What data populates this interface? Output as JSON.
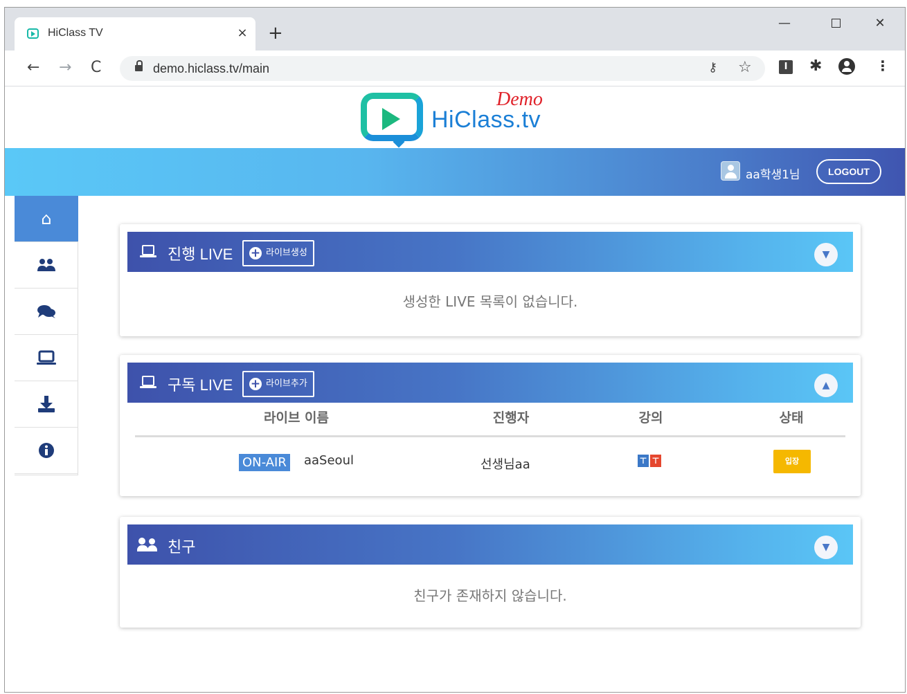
{
  "browser": {
    "tab_title": "HiClass TV",
    "tab_close": "×",
    "new_tab": "+",
    "url": "demo.hiclass.tv/main",
    "window_controls": {
      "minimize": "—",
      "close": "✕"
    },
    "nav": {
      "back": "←",
      "forward": "→",
      "reload": "C"
    },
    "icons": [
      "lock-icon",
      "key-icon",
      "star-icon",
      "extension-i-icon",
      "puzzle-icon",
      "account-icon",
      "menu-icon"
    ]
  },
  "logo": {
    "text": "HiClass.tv",
    "badge": "Demo"
  },
  "header": {
    "user_name": "aa학생1님",
    "logout_label": "LOGOUT"
  },
  "sidebar": {
    "items": [
      {
        "name": "home",
        "icon": "home-icon",
        "active": true
      },
      {
        "name": "users",
        "icon": "users-icon",
        "active": false
      },
      {
        "name": "chat",
        "icon": "comments-icon",
        "active": false
      },
      {
        "name": "live",
        "icon": "laptop-icon",
        "active": false
      },
      {
        "name": "download",
        "icon": "download-icon",
        "active": false
      },
      {
        "name": "info",
        "icon": "info-icon",
        "active": false
      }
    ]
  },
  "panels": {
    "live_hosting": {
      "title": "진행 LIVE",
      "add_label": "라이브생성",
      "empty_text": "생성한 LIVE 목록이 없습니다.",
      "expanded": false
    },
    "live_subscribed": {
      "title": "구독 LIVE",
      "add_label": "라이브추가",
      "expanded": true,
      "columns": [
        "라이브 이름",
        "진행자",
        "강의",
        "상태"
      ],
      "rows": [
        {
          "status_badge": "ON-AIR",
          "name": "aaSeoul",
          "host": "선생님aa",
          "lecture_icons": [
            "pin-blue-icon",
            "pin-red-icon"
          ],
          "action": "입장"
        }
      ]
    },
    "friends": {
      "title": "친구",
      "empty_text": "친구가 존재하지 않습니다.",
      "expanded": false
    }
  },
  "colors": {
    "accent": "#4a8ad8",
    "header_gradient_start": "#5ac8f7",
    "header_gradient_end": "#3f55b0",
    "enter_button": "#f5b800",
    "logo_red": "#e0222a",
    "logo_blue": "#1b7fd6"
  }
}
